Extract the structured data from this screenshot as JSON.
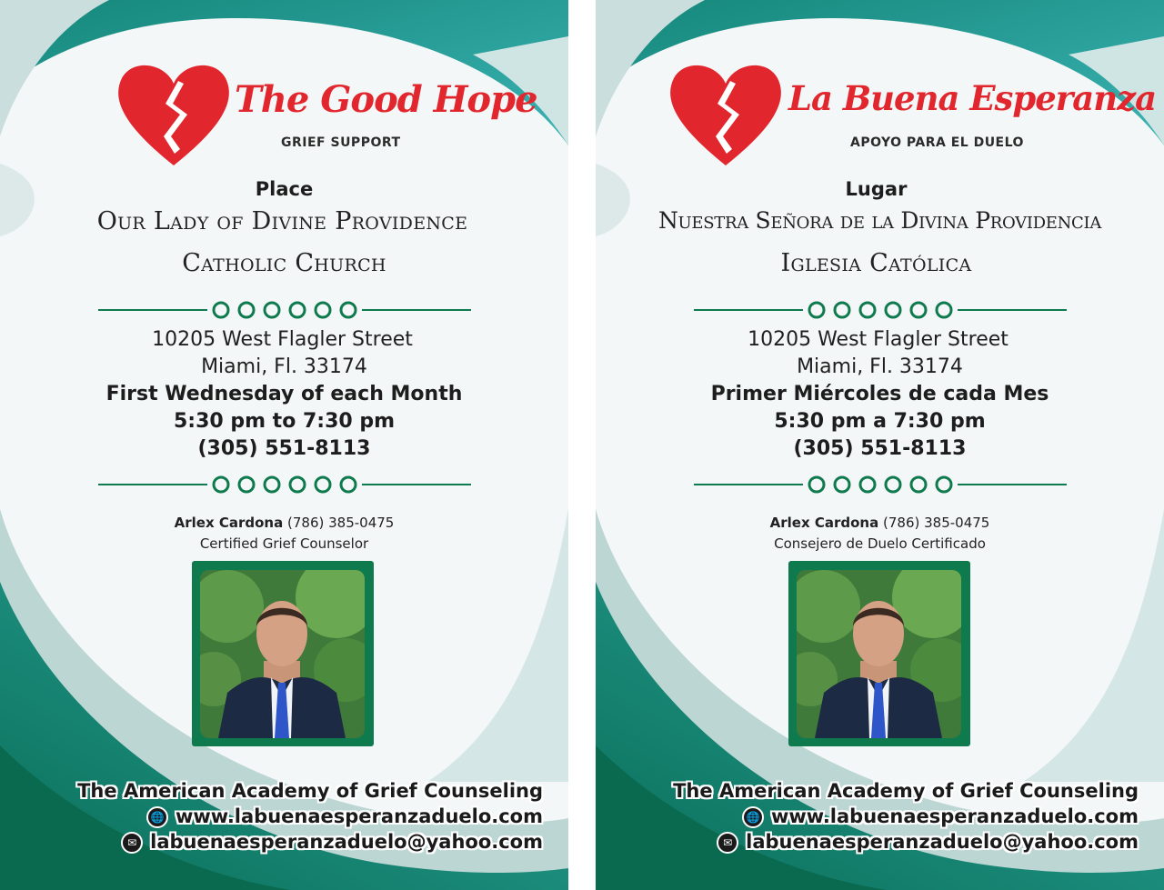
{
  "cards": [
    {
      "brand": "The Good Hope",
      "brand_sub": "GRIEF SUPPORT",
      "place_label": "Place",
      "place_line1": "Our Lady of Divine Providence",
      "place_line2": "Catholic Church",
      "address1": "10205 West Flagler Street",
      "address2": "Miami, Fl. 33174",
      "schedule": "First Wednesday of each Month",
      "time": "5:30 pm to 7:30 pm",
      "phone": "(305) 551-8113",
      "counselor_name": "Arlex Cardona",
      "counselor_phone": "(786) 385-0475",
      "counselor_title": "Certified Grief Counselor",
      "academy": "The American Academy of Grief Counseling",
      "website": "www.labuenaesperanzaduelo.com",
      "email": "labuenaesperanzaduelo@yahoo.com"
    },
    {
      "brand": "La Buena Esperanza",
      "brand_sub": "APOYO PARA EL DUELO",
      "place_label": "Lugar",
      "place_line1": "Nuestra Señora de la Divina Providencia",
      "place_line2": "Iglesia Católica",
      "address1": "10205 West Flagler Street",
      "address2": "Miami, Fl. 33174",
      "schedule": "Primer Miércoles de cada Mes",
      "time": "5:30 pm a 7:30 pm",
      "phone": "(305) 551-8113",
      "counselor_name": "Arlex Cardona",
      "counselor_phone": "(786) 385-0475",
      "counselor_title": "Consejero de Duelo Certificado",
      "academy": "The American Academy of Grief Counseling",
      "website": "www.labuenaesperanzaduelo.com",
      "email": "labuenaesperanzaduelo@yahoo.com"
    }
  ],
  "icons": [
    "broken-heart-icon",
    "ornamental-divider-icon",
    "globe-icon",
    "envelope-icon"
  ],
  "colors": {
    "teal": "#1a9a9b",
    "green": "#0e7a4e",
    "heart_red": "#e1262d"
  }
}
